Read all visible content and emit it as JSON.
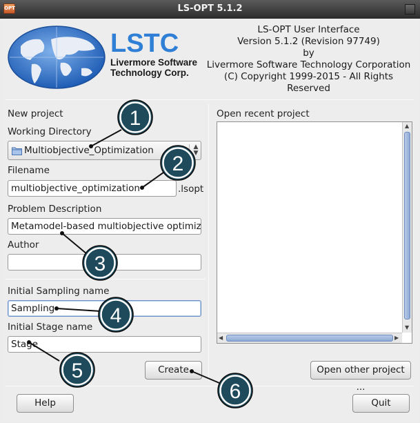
{
  "window": {
    "title": "LS-OPT 5.1.2",
    "app_icon_text": "OPT"
  },
  "logo": {
    "name": "LSTC",
    "line1": "Livermore Software",
    "line2": "Technology Corp."
  },
  "about": {
    "line1": "LS-OPT User Interface",
    "line2": "Version 5.1.2 (Revision 97749)",
    "line3": "by",
    "line4": "Livermore Software Technology Corporation",
    "line5": "(C) Copyright 1999-2015 - All Rights Reserved"
  },
  "new_project": {
    "heading": "New project",
    "working_dir_label": "Working Directory",
    "working_dir_value": "Multiobjective_Optimization",
    "filename_label": "Filename",
    "filename_value": "multiobjective_optimization",
    "filename_ext": ".lsopt",
    "description_label": "Problem Description",
    "description_value": "Metamodel-based multiobjective optimiza",
    "author_label": "Author",
    "author_value": "",
    "sampling_label": "Initial Sampling name",
    "sampling_value": "Sampling",
    "stage_label": "Initial Stage name",
    "stage_value": "Stage",
    "create_label": "Create"
  },
  "recent": {
    "heading": "Open recent project",
    "open_other_label": "Open other project ..."
  },
  "footer": {
    "help_label": "Help",
    "quit_label": "Quit"
  },
  "callouts": [
    "1",
    "2",
    "3",
    "4",
    "5",
    "6"
  ],
  "colors": {
    "callout_fill": "#1e4a5c",
    "callout_ring": "#ffffff",
    "scroll_thumb": "#8eaad4",
    "focus_border": "#6b8fc7"
  },
  "icons": {
    "folder": "folder-icon",
    "close": "close-icon",
    "spin": "updown-spin-icon"
  }
}
